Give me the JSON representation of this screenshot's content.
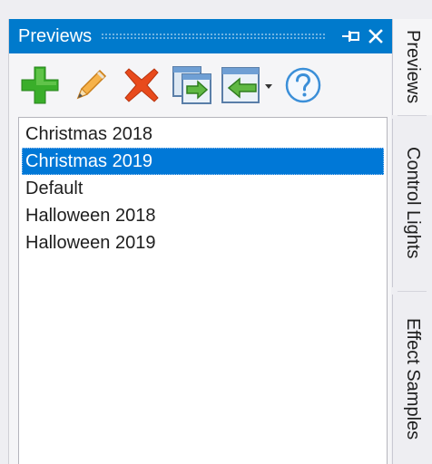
{
  "panel": {
    "title": "Previews"
  },
  "titlebar_icons": [
    "pin-icon",
    "close-icon"
  ],
  "toolbar": {
    "tools": [
      {
        "name": "add-button",
        "icon": "plus-icon",
        "color": "#2e9e2e"
      },
      {
        "name": "edit-button",
        "icon": "pencil-icon",
        "color": "#f2a33a"
      },
      {
        "name": "delete-button",
        "icon": "red-x-icon",
        "color": "#e8401c"
      },
      {
        "name": "copy-button",
        "icon": "copy-arrow-icon",
        "color": "#4a90c8"
      },
      {
        "name": "import-button",
        "icon": "import-arrow-icon",
        "color": "#3a9a3a"
      },
      {
        "name": "help-button",
        "icon": "question-circle-icon",
        "color": "#3b8fd8"
      }
    ]
  },
  "list": {
    "items": [
      {
        "label": "Christmas 2018",
        "selected": false
      },
      {
        "label": "Christmas 2019",
        "selected": true
      },
      {
        "label": "Default",
        "selected": false
      },
      {
        "label": "Halloween 2018",
        "selected": false
      },
      {
        "label": "Halloween 2019",
        "selected": false
      }
    ]
  },
  "side_tabs": [
    {
      "label": "Previews",
      "active": true
    },
    {
      "label": "Control Lights",
      "active": false
    },
    {
      "label": "Effect Samples",
      "active": false
    }
  ],
  "colors": {
    "accent": "#007acc",
    "selection": "#0078d7",
    "background": "#eeeef2"
  }
}
